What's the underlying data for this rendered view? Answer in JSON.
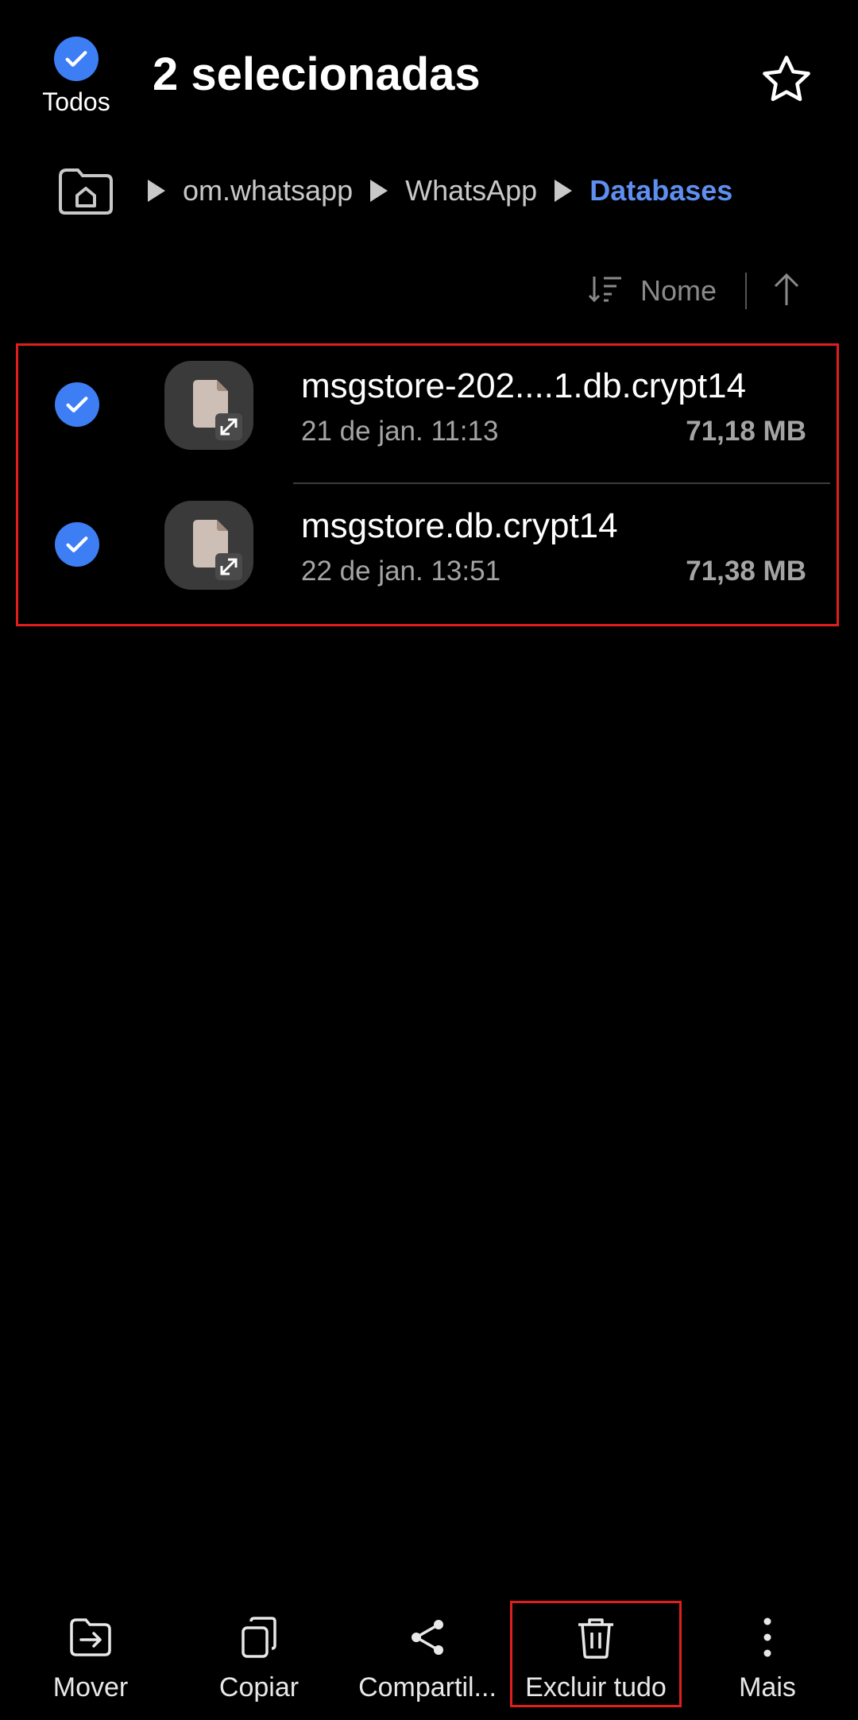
{
  "header": {
    "select_all_label": "Todos",
    "title": "2 selecionadas",
    "favorite_icon": "star-icon"
  },
  "breadcrumb": {
    "home_icon": "home-folder-icon",
    "items": [
      "om.whatsapp",
      "WhatsApp"
    ],
    "current": "Databases"
  },
  "sort": {
    "label": "Nome",
    "direction": "ascending"
  },
  "files": [
    {
      "name": "msgstore-202....1.db.crypt14",
      "date": "21 de jan. 11:13",
      "size": "71,18 MB",
      "selected": true
    },
    {
      "name": "msgstore.db.crypt14",
      "date": "22 de jan. 13:51",
      "size": "71,38 MB",
      "selected": true
    }
  ],
  "toolbar": {
    "items": [
      {
        "label": "Mover",
        "icon": "move-icon"
      },
      {
        "label": "Copiar",
        "icon": "copy-icon"
      },
      {
        "label": "Compartil...",
        "icon": "share-icon"
      },
      {
        "label": "Excluir tudo",
        "icon": "trash-icon"
      },
      {
        "label": "Mais",
        "icon": "more-vertical-icon"
      }
    ]
  },
  "colors": {
    "accent": "#3d7ef4",
    "breadcrumb_current": "#5e8ff0",
    "highlight": "#e01e1e",
    "background": "#000000"
  }
}
